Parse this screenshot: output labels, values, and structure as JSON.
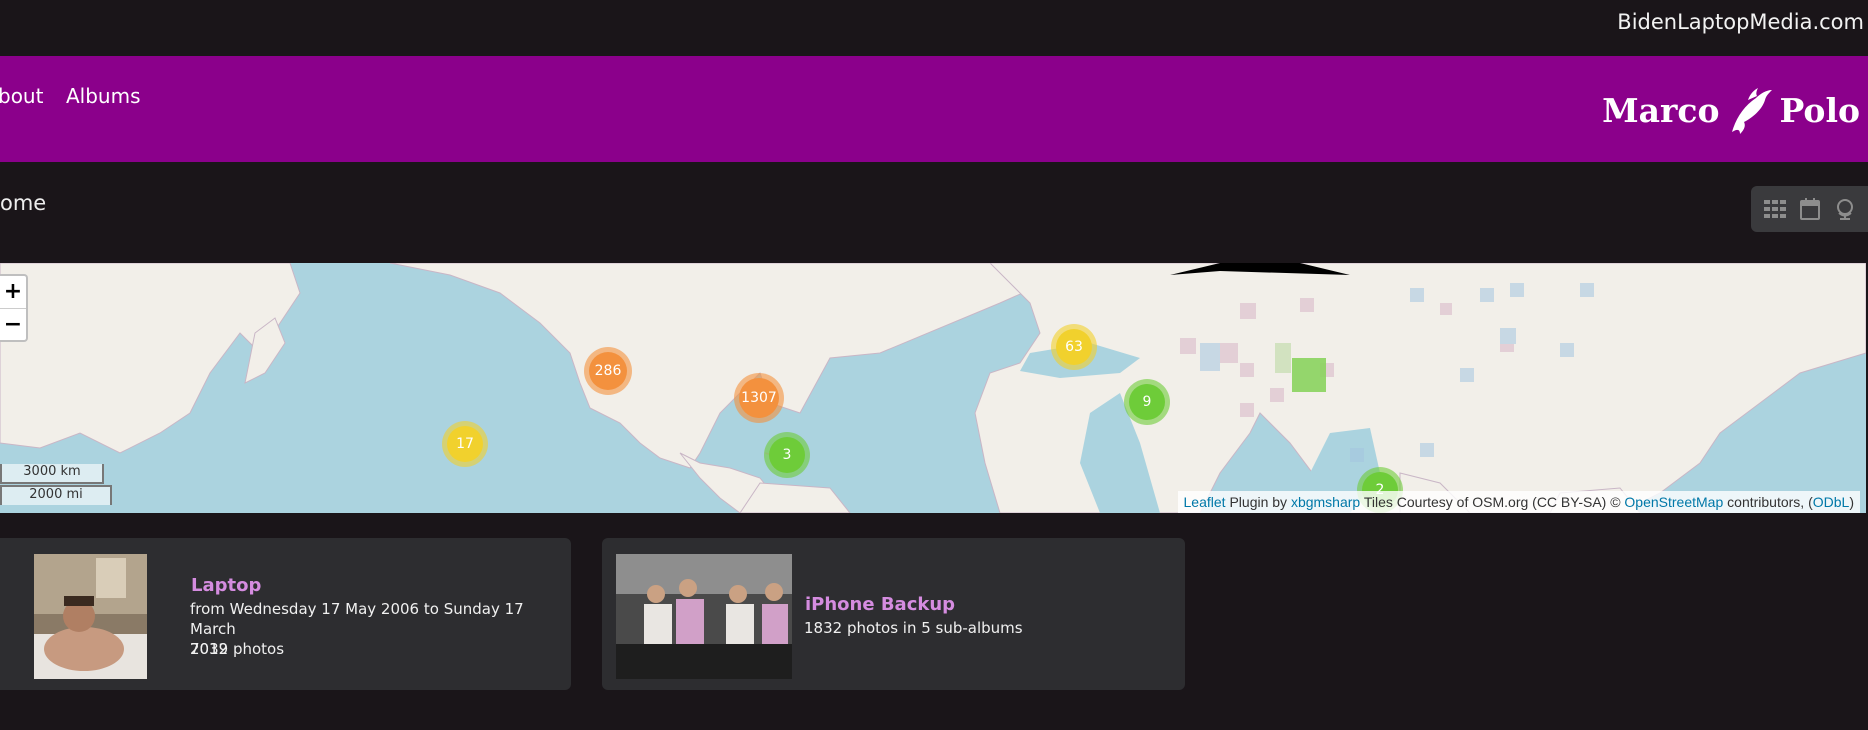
{
  "header": {
    "site_name": "BidenLaptopMedia.com"
  },
  "nav": {
    "links": [
      "bout",
      "Albums"
    ],
    "logo_left": "Marco",
    "logo_right": "Polo",
    "background": "#8b008b"
  },
  "breadcrumb": {
    "label": "ome"
  },
  "view_switcher": {
    "icons": [
      "grid-icon",
      "calendar-icon",
      "globe-icon"
    ]
  },
  "map": {
    "zoom_in": "+",
    "zoom_out": "−",
    "scale_km": "3000 km",
    "scale_mi": "2000 mi",
    "clusters": [
      {
        "count": "286",
        "color": "#f3913e"
      },
      {
        "count": "1307",
        "color": "#f3913e"
      },
      {
        "count": "17",
        "color": "#f1d12d"
      },
      {
        "count": "3",
        "color": "#6ecc39"
      },
      {
        "count": "63",
        "color": "#f1d12d"
      },
      {
        "count": "9",
        "color": "#6ecc39"
      },
      {
        "count": "2",
        "color": "#6ecc39"
      }
    ],
    "attribution": {
      "leaflet": "Leaflet",
      "plugin_by": "Plugin by",
      "author": "xbgmsharp",
      "tiles": "Tiles Courtesy of OSM.org (CC BY-SA) ©",
      "osm": "OpenStreetMap",
      "contributors": "contributors, (",
      "odbl": "ODbL",
      "close": ")"
    }
  },
  "albums": [
    {
      "title": "Laptop",
      "date_line1": "from Wednesday 17 May 2006 to Sunday 17 March",
      "date_line2": "2019",
      "count": "7032 photos"
    },
    {
      "title": "iPhone Backup",
      "count": "1832 photos in 5 sub-albums"
    }
  ]
}
